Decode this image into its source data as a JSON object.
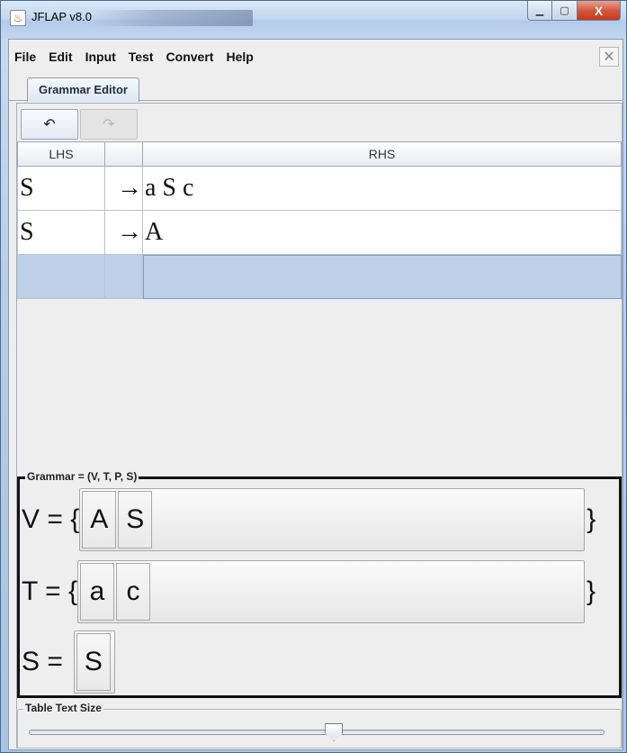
{
  "window": {
    "title": "JFLAP v8.0",
    "minimize": "▁",
    "maximize": "▢",
    "close": "X"
  },
  "menubar": {
    "items": [
      "File",
      "Edit",
      "Input",
      "Test",
      "Convert",
      "Help"
    ],
    "close_glyph": "✕"
  },
  "tabs": [
    {
      "label": "Grammar Editor",
      "selected": true
    }
  ],
  "toolbar": {
    "undo_glyph": "↶",
    "redo_glyph": "↷",
    "redo_enabled": false
  },
  "table": {
    "headers": {
      "lhs": "LHS",
      "arrow": "",
      "rhs": "RHS"
    },
    "rows": [
      {
        "lhs": "S",
        "arrow": "→",
        "rhs": "a S c"
      },
      {
        "lhs": "S",
        "arrow": "→",
        "rhs": "A"
      },
      {
        "lhs": "",
        "arrow": "",
        "rhs": ""
      }
    ],
    "selected_row": 2
  },
  "grammar": {
    "legend": "Grammar = (V, T, P, S)",
    "v_label": "V = {",
    "t_label": "T = {",
    "s_label": "S =",
    "close_brace": "}",
    "variables": [
      "A",
      "S"
    ],
    "terminals": [
      "a",
      "c"
    ],
    "start": "S"
  },
  "text_size": {
    "legend": "Table Text Size",
    "value_fraction": 0.53
  },
  "colors": {
    "selection": "#bed0e7",
    "grammar_border": "#111111"
  }
}
